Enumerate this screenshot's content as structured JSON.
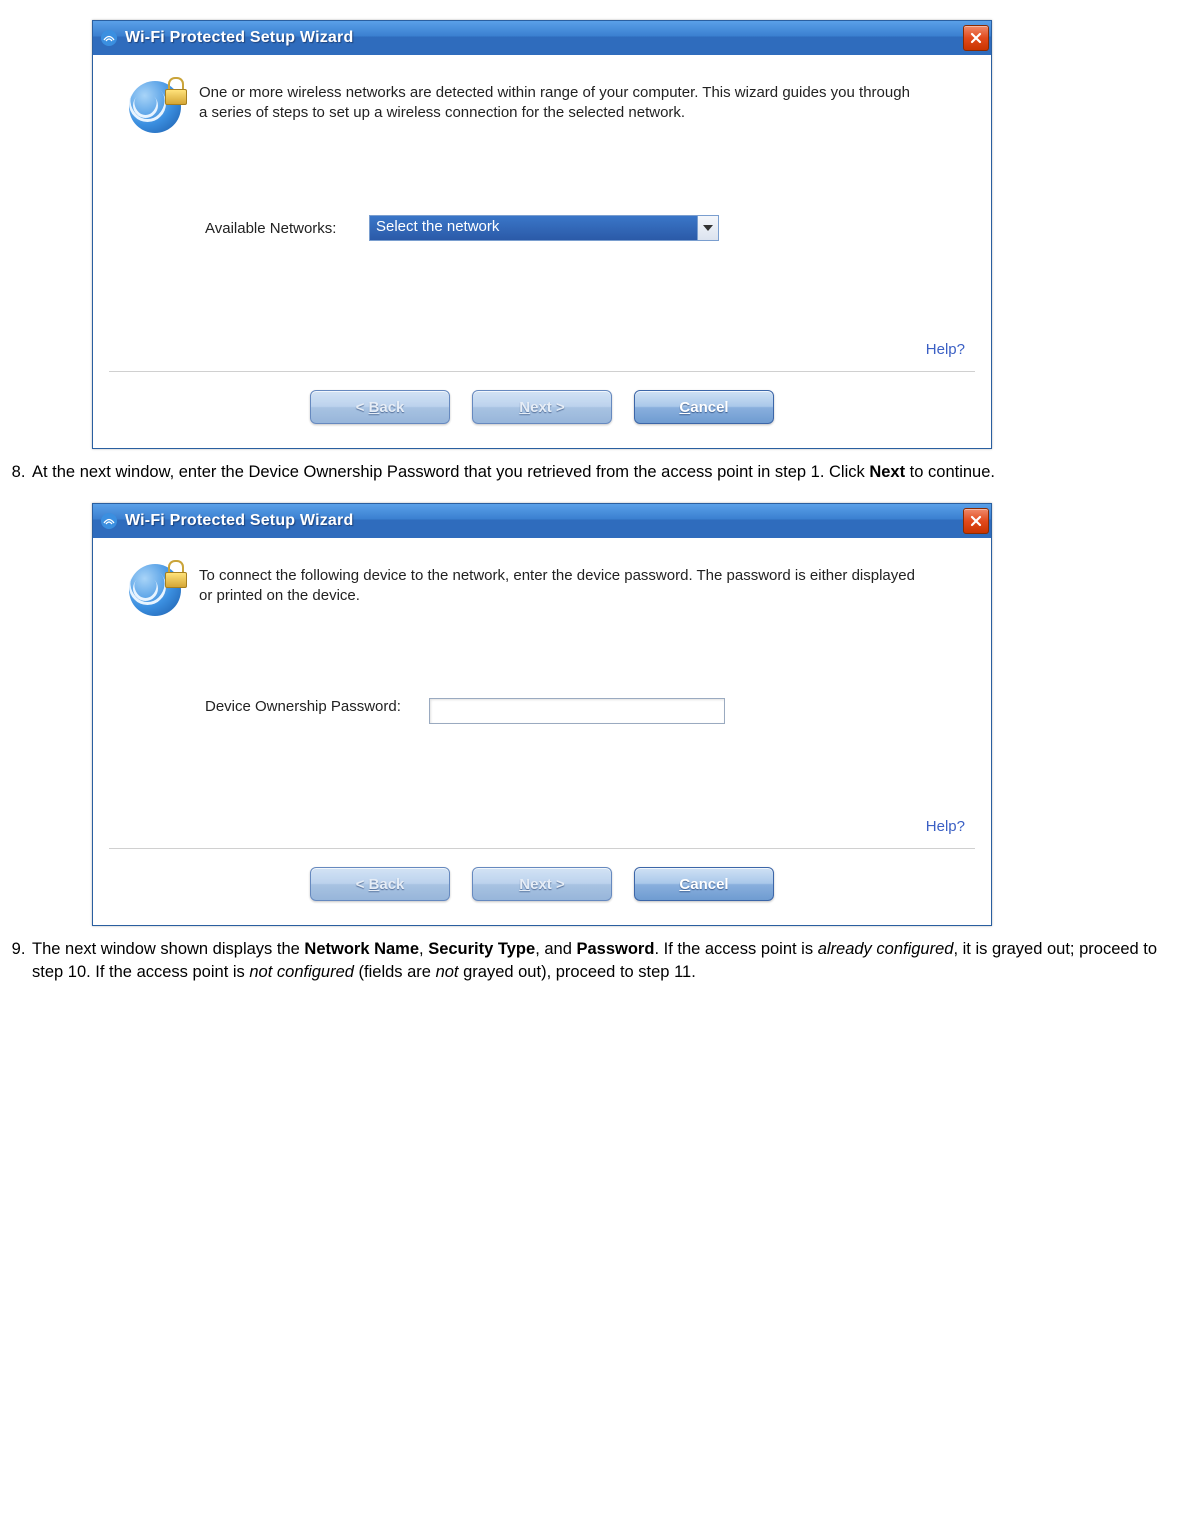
{
  "window1": {
    "title": "Wi-Fi Protected Setup Wizard",
    "intro": "One or more wireless networks are detected within range of your computer. This wizard guides you through a series of steps to set up a wireless connection for the selected network.",
    "available_label": "Available Networks:",
    "dropdown_value": "Select the network",
    "help": "Help?",
    "back": "< Back",
    "next": "Next >",
    "cancel": "Cancel"
  },
  "window2": {
    "title": "Wi-Fi Protected Setup Wizard",
    "intro": "To connect the following device to the network, enter the device password. The password is either displayed or printed on the device.",
    "pw_label": "Device Ownership Password:",
    "help": "Help?",
    "back": "< Back",
    "next": "Next >",
    "cancel": "Cancel"
  },
  "step8": {
    "num": "8.",
    "pre": "At the next window, enter the Device Ownership Password that you retrieved from the access point in step 1. Click ",
    "bold": "Next",
    "post": " to continue."
  },
  "step9": {
    "num": "9.",
    "pre": "The next window shown displays the ",
    "b1": "Network Name",
    "c1": ", ",
    "b2": "Security Type",
    "c2": ", and ",
    "b3": "Password",
    "post1": ". If the access point is ",
    "i1": "already configured",
    "post2": ", it is grayed out; proceed to step 10. If the access point is ",
    "i2": "not configured",
    "post3": " (fields are ",
    "i3": "not",
    "post4": " grayed out), proceed to step 11."
  }
}
